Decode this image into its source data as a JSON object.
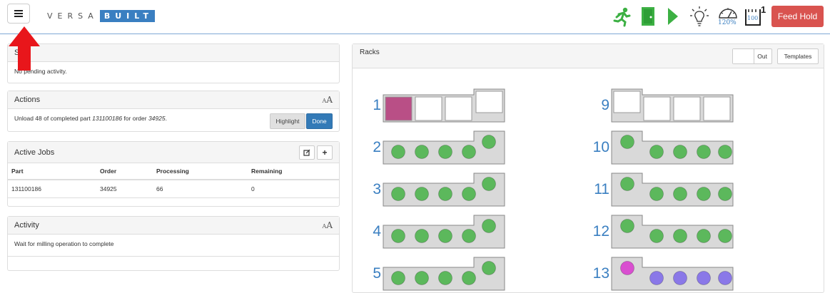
{
  "header": {
    "logo_plain": "VERSA",
    "logo_boxed": "BUILT",
    "feed_hold_label": "Feed Hold",
    "speed_label": "120%",
    "counter_label": "100",
    "counter_sup": "1",
    "icons": [
      "menu-icon",
      "running-person-icon",
      "door-icon",
      "play-icon",
      "lightbulb-icon",
      "speedometer-icon",
      "counter-icon"
    ]
  },
  "status_panel": {
    "title": "St",
    "body": "No pending activity."
  },
  "actions_panel": {
    "title": "Actions",
    "font_small": "A",
    "font_large": "A",
    "text_prefix": "Unload 48 of completed part ",
    "part": "131100186",
    "text_mid": " for order ",
    "order": "34925",
    "text_suffix": ".",
    "highlight_label": "Highlight",
    "done_label": "Done"
  },
  "jobs_panel": {
    "title": "Active Jobs",
    "add_label": "+",
    "columns": [
      "Part",
      "Order",
      "Processing",
      "Remaining"
    ],
    "rows": [
      [
        "131100186",
        "34925",
        "66",
        "0"
      ]
    ]
  },
  "activity_panel": {
    "title": "Activity",
    "font_small": "A",
    "font_large": "A",
    "body": "Wait for milling operation to complete"
  },
  "racks_panel": {
    "title": "Racks",
    "out_label": "Out",
    "templates_label": "Templates",
    "colors": {
      "rack_fill": "#d9d9d9",
      "rack_stroke": "#888888",
      "green": "#5cb85c",
      "magenta_block": "#b94f86",
      "magenta_dot": "#d94fd0",
      "purple": "#8a78e8"
    },
    "left_column": [
      {
        "number": "1",
        "kind": "slots",
        "filled": "first"
      },
      {
        "number": "2",
        "kind": "dots",
        "dots": [
          "green",
          "green",
          "green",
          "green",
          "green"
        ]
      },
      {
        "number": "3",
        "kind": "dots",
        "dots": [
          "green",
          "green",
          "green",
          "green",
          "green"
        ]
      },
      {
        "number": "4",
        "kind": "dots",
        "dots": [
          "green",
          "green",
          "green",
          "green",
          "green"
        ]
      },
      {
        "number": "5",
        "kind": "dots",
        "dots": [
          "green",
          "green",
          "green",
          "green",
          "green"
        ]
      }
    ],
    "right_column": [
      {
        "number": "9",
        "kind": "slots",
        "filled": "none"
      },
      {
        "number": "10",
        "kind": "dots",
        "dots": [
          "green",
          "green",
          "green",
          "green",
          "green"
        ]
      },
      {
        "number": "11",
        "kind": "dots",
        "dots": [
          "green",
          "green",
          "green",
          "green",
          "green"
        ]
      },
      {
        "number": "12",
        "kind": "dots",
        "dots": [
          "green",
          "green",
          "green",
          "green",
          "green"
        ]
      },
      {
        "number": "13",
        "kind": "dots",
        "dots": [
          "magenta",
          "purple",
          "purple",
          "purple",
          "purple"
        ]
      }
    ]
  }
}
